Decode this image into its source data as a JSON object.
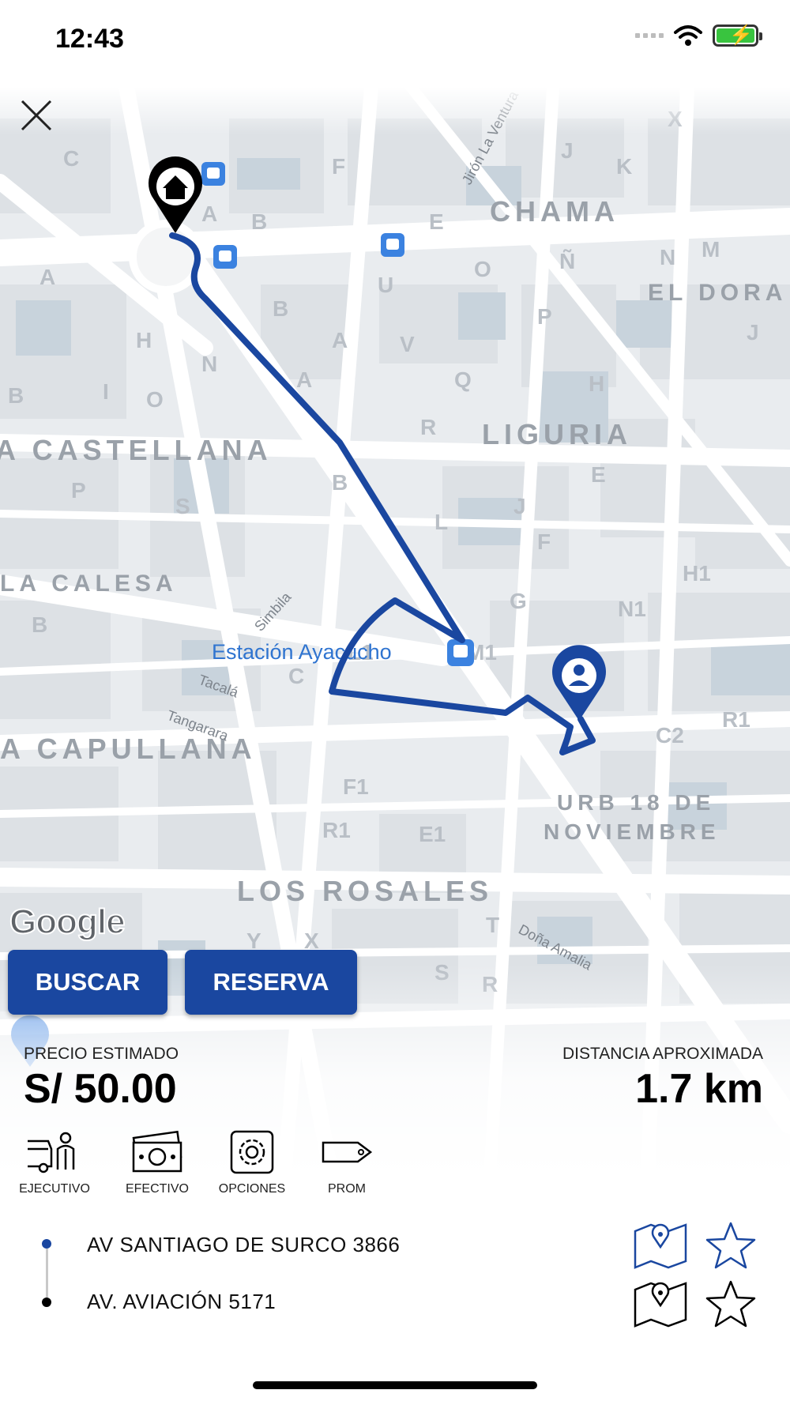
{
  "status_bar": {
    "time": "12:43"
  },
  "map": {
    "street_labels": [
      {
        "text": "CHAMA"
      },
      {
        "text": "EL DORA"
      },
      {
        "text": "LIGURIA"
      },
      {
        "text": "A CASTELLANA"
      },
      {
        "text": "LA CALESA"
      },
      {
        "text": "A CAPULLANA"
      },
      {
        "text": "URB 18 DE"
      },
      {
        "text": "NOVIEMBRE"
      },
      {
        "text": "LOS ROSALES"
      },
      {
        "text": "Jirón La Ventura"
      },
      {
        "text": "Simbila"
      },
      {
        "text": "Tacalá"
      },
      {
        "text": "Tangarara"
      },
      {
        "text": "Doña Amalia"
      }
    ],
    "station_label": "Estación Ayacucho",
    "attribution": "Google",
    "colors": {
      "route": "#1a47a0",
      "background": "#e9ecef",
      "road": "#ffffff",
      "block": "#dde1e5",
      "park": "#c8d3dc"
    }
  },
  "actions": {
    "search_label": "BUSCAR",
    "reserve_label": "RESERVA"
  },
  "estimate": {
    "price_label": "PRECIO ESTIMADO",
    "price_value": "S/ 50.00",
    "distance_label": "DISTANCIA APROXIMADA",
    "distance_value": "1.7 km"
  },
  "options": [
    {
      "label": "EJECUTIVO",
      "icon": "executive-car-icon"
    },
    {
      "label": "EFECTIVO",
      "icon": "cash-icon"
    },
    {
      "label": "OPCIONES",
      "icon": "gear-icon"
    },
    {
      "label": "PROM",
      "icon": "tag-icon"
    }
  ],
  "trip": {
    "origin": "AV SANTIAGO DE SURCO 3866",
    "destination": "AV. AVIACIÓN 5171"
  }
}
